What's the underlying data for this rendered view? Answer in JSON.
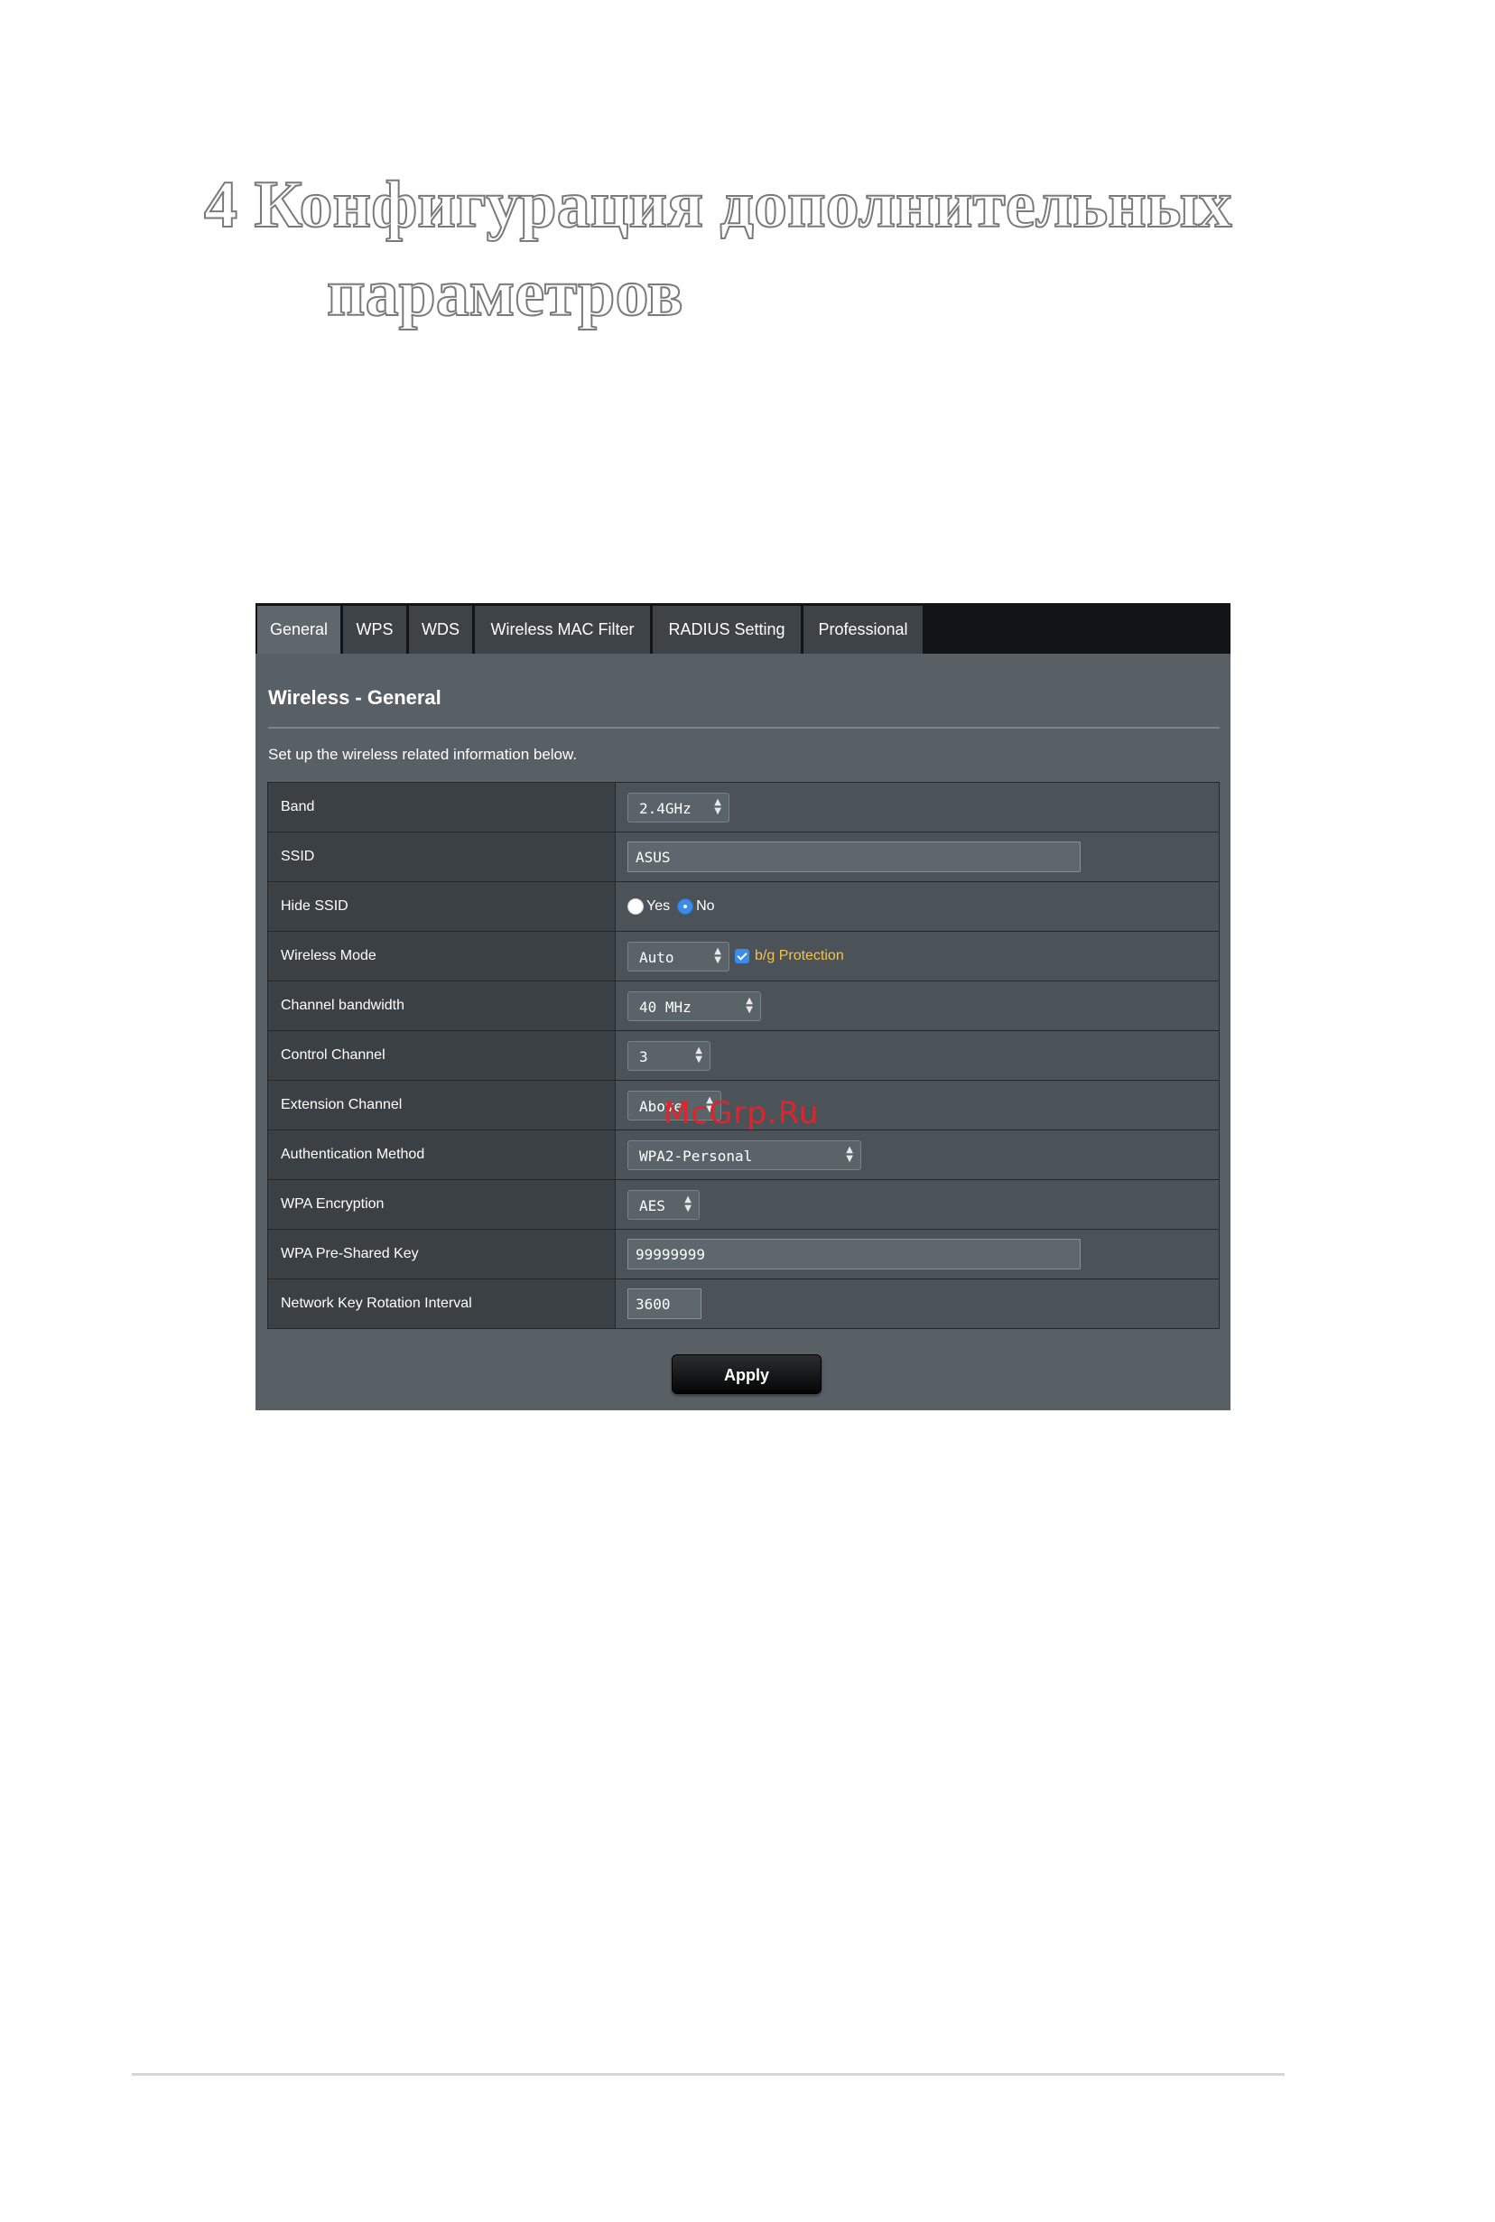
{
  "document": {
    "chapter_title_line1": "4 Конфигурация дополнительных",
    "chapter_title_line2": "параметров",
    "watermark": "McGrp.Ru"
  },
  "tabs": [
    {
      "label": "General",
      "active": true
    },
    {
      "label": "WPS"
    },
    {
      "label": "WDS"
    },
    {
      "label": "Wireless MAC Filter"
    },
    {
      "label": "RADIUS Setting"
    },
    {
      "label": "Professional"
    }
  ],
  "section": {
    "title": "Wireless - General",
    "description": "Set up the wireless related information below."
  },
  "rows": {
    "band": {
      "label": "Band",
      "value": "2.4GHz"
    },
    "ssid": {
      "label": "SSID",
      "value": "ASUS"
    },
    "hide_ssid": {
      "label": "Hide SSID",
      "option_yes": "Yes",
      "option_no": "No",
      "selected": "No"
    },
    "wireless_mode": {
      "label": "Wireless Mode",
      "value": "Auto",
      "protection_label": "b/g Protection",
      "protection_checked": true
    },
    "channel_bandwidth": {
      "label": "Channel bandwidth",
      "value": "40 MHz"
    },
    "control_channel": {
      "label": "Control Channel",
      "value": "3"
    },
    "extension_channel": {
      "label": "Extension Channel",
      "value": "Above"
    },
    "auth_method": {
      "label": "Authentication Method",
      "value": "WPA2-Personal"
    },
    "wpa_encryption": {
      "label": "WPA Encryption",
      "value": "AES"
    },
    "wpa_psk": {
      "label": "WPA Pre-Shared Key",
      "value": "99999999"
    },
    "key_rotation": {
      "label": "Network Key Rotation Interval",
      "value": "3600"
    }
  },
  "apply_label": "Apply",
  "colors": {
    "panel_bg": "#596065",
    "tabbar_bg": "#121416",
    "accent_blue": "#3b8ce8",
    "protection_text": "#f5c24a",
    "watermark_red": "#e0242b"
  },
  "icons": {
    "select_arrow": "up-down-arrows-icon",
    "radio": "radio-button-icon",
    "checkbox": "checkbox-checked-icon"
  }
}
